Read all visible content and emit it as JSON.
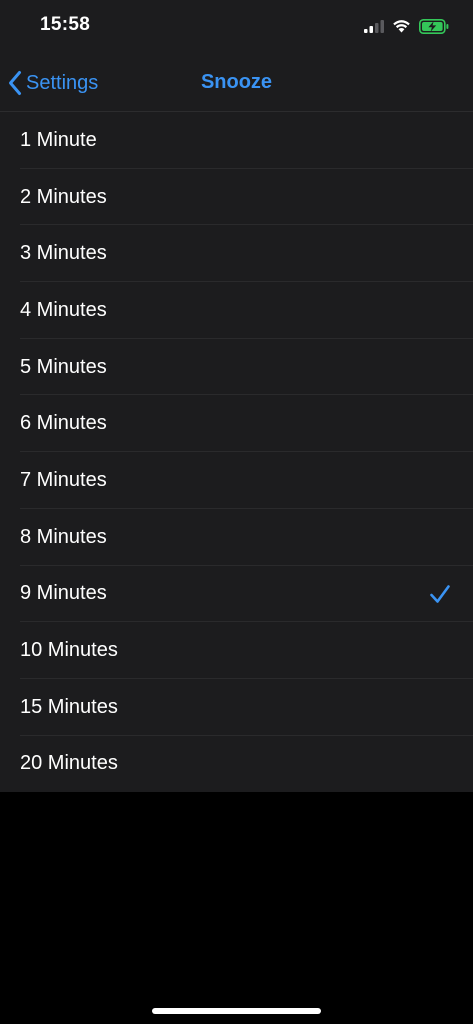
{
  "status_bar": {
    "time": "15:58"
  },
  "icons": {
    "signal": "cellular-signal-icon",
    "wifi": "wifi-icon",
    "battery": "battery-charging-icon",
    "back": "chevron-left-icon",
    "check": "checkmark-icon"
  },
  "colors": {
    "accent": "#3a93f3",
    "background": "#000000",
    "list_background": "#1c1c1e",
    "battery": "#34c759"
  },
  "nav": {
    "back_label": "Settings",
    "title": "Snooze"
  },
  "options": [
    {
      "label": "1 Minute",
      "selected": false
    },
    {
      "label": "2 Minutes",
      "selected": false
    },
    {
      "label": "3 Minutes",
      "selected": false
    },
    {
      "label": "4 Minutes",
      "selected": false
    },
    {
      "label": "5 Minutes",
      "selected": false
    },
    {
      "label": "6 Minutes",
      "selected": false
    },
    {
      "label": "7 Minutes",
      "selected": false
    },
    {
      "label": "8 Minutes",
      "selected": false
    },
    {
      "label": "9 Minutes",
      "selected": true
    },
    {
      "label": "10 Minutes",
      "selected": false
    },
    {
      "label": "15 Minutes",
      "selected": false
    },
    {
      "label": "20 Minutes",
      "selected": false
    }
  ]
}
